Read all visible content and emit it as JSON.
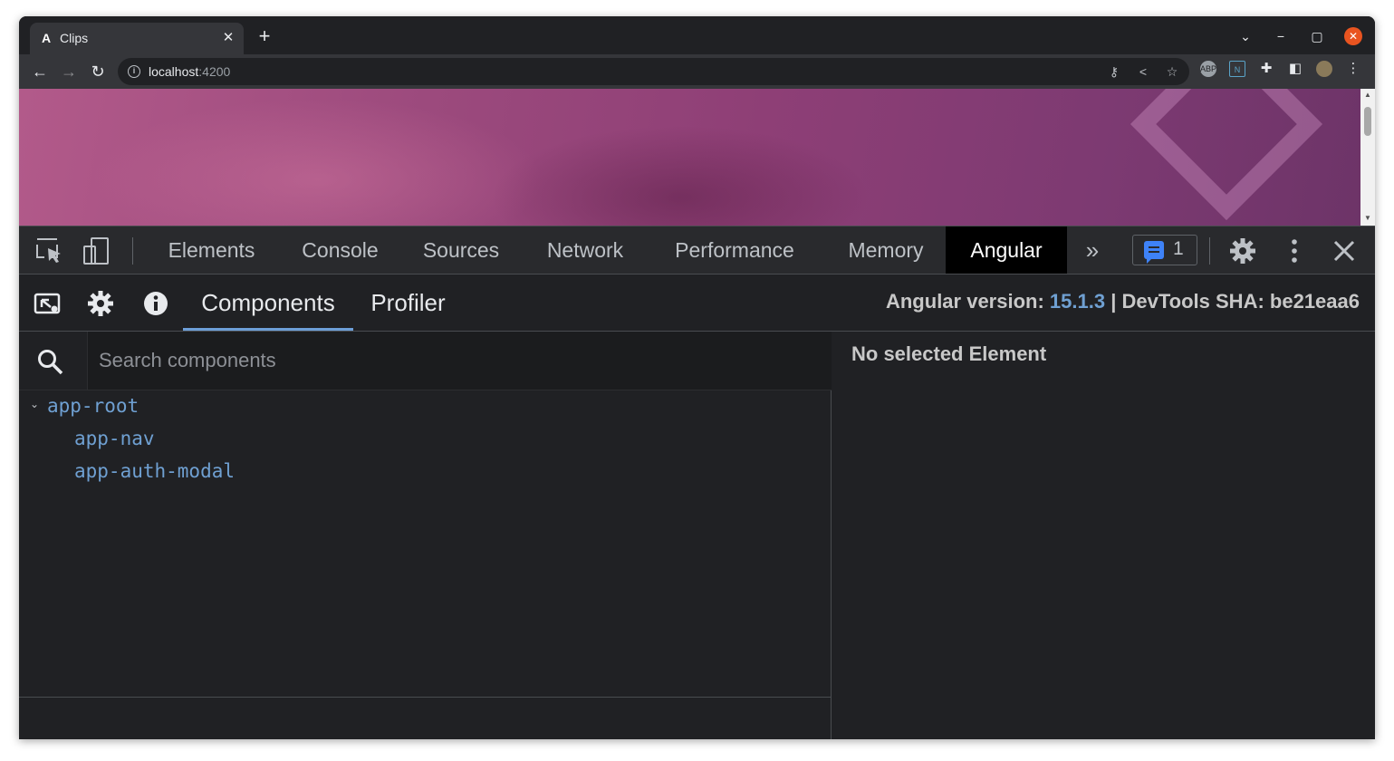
{
  "browser": {
    "tab": {
      "title": "Clips",
      "favicon": "A"
    },
    "url": {
      "host": "localhost",
      "port": ":4200"
    }
  },
  "devtools": {
    "tabs": [
      "Elements",
      "Console",
      "Sources",
      "Network",
      "Performance",
      "Memory",
      "Angular"
    ],
    "active_tab": "Angular",
    "issues_count": "1"
  },
  "angular": {
    "subtabs": [
      "Components",
      "Profiler"
    ],
    "active_subtab": "Components",
    "version_label": "Angular version:",
    "version": "15.1.3",
    "separator": "|",
    "sha_label": "DevTools SHA:",
    "sha": "be21eaa6",
    "search_placeholder": "Search components",
    "tree": [
      "app-root",
      "app-nav",
      "app-auth-modal"
    ],
    "details_empty": "No selected Element"
  },
  "colors": {
    "accent": "#6fa0d2",
    "issues_blue": "#3e82f7",
    "window_close": "#e95420"
  }
}
